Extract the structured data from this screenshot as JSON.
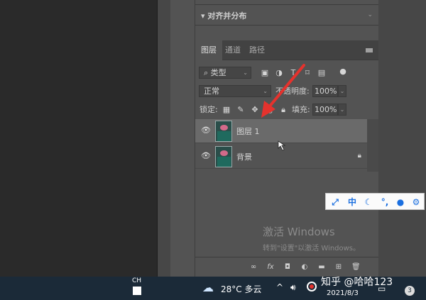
{
  "align_panel": {
    "title": "对齐并分布"
  },
  "layers_panel": {
    "tabs": [
      "图层",
      "通道",
      "路径"
    ],
    "filter_type": "类型",
    "blend_mode": "正常",
    "opacity_label": "不透明度:",
    "opacity_value": "100%",
    "lock_label": "锁定:",
    "fill_label": "填充:",
    "fill_value": "100%",
    "layers": [
      {
        "name": "图层 1",
        "selected": true,
        "locked": false
      },
      {
        "name": "背景",
        "selected": false,
        "locked": true
      }
    ],
    "bottom_icons": [
      "link-icon",
      "fx-icon",
      "mask-icon",
      "adjustment-icon",
      "group-folder-icon",
      "new-layer-icon",
      "trash-icon"
    ],
    "fx_label": "fx"
  },
  "ime_toolbar": {
    "mode_label": "中"
  },
  "watermark": {
    "line1": "激活 Windows",
    "line2": "转到\"设置\"以激活 Windows。"
  },
  "taskbar": {
    "input_lang": "CH",
    "weather": "28°C 多云",
    "date": "2021/8/3",
    "notification_count": "3"
  },
  "overlay": {
    "site_watermark": "知乎 @哈哈123"
  },
  "colors": {
    "accent_red": "#e5322d",
    "ime_blue": "#1a6fe0",
    "taskbar": "#1b2a38"
  }
}
